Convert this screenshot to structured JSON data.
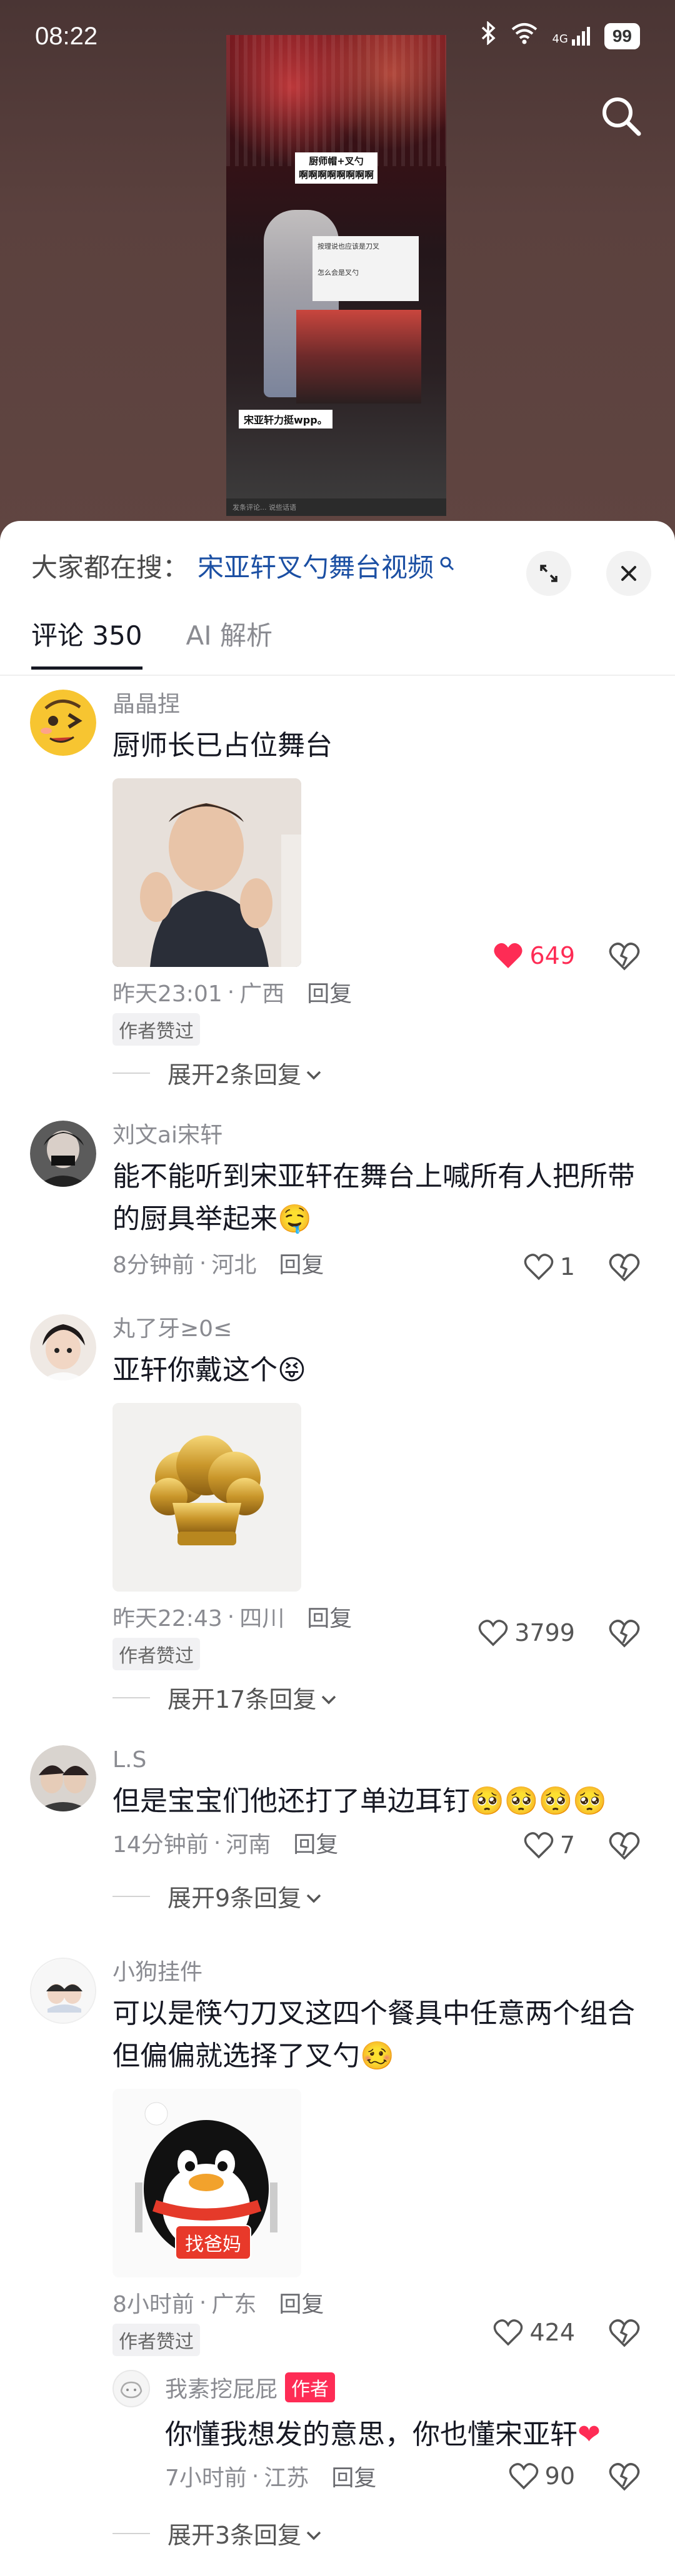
{
  "status_bar": {
    "time": "08:22",
    "battery": "99",
    "network": "4G"
  },
  "video": {
    "caption_top": "厨师帽+叉勺\n啊啊啊啊啊啊啊啊",
    "box_line1": "按理说也应该是刀叉",
    "box_line2": "怎么会是叉勺",
    "caption_bottom": "宋亚轩力挺wpp。",
    "bottom_bar": "发条评论... 说些话语"
  },
  "sheet": {
    "search_prefix": "大家都在搜：",
    "search_link": "宋亚轩叉勺舞台视频",
    "tabs": [
      {
        "label": "评论 350",
        "active": true
      },
      {
        "label": "AI 解析",
        "active": false
      }
    ]
  },
  "comments": [
    {
      "user": "晶晶捏",
      "text": "厨师长已占位舞台",
      "time": "昨天23:01",
      "location": "广西",
      "reply": "回复",
      "likes": "649",
      "liked": true,
      "author_liked": "作者赞过",
      "expand": "展开2条回复"
    },
    {
      "user": "刘文ai宋轩",
      "text": "能不能听到宋亚轩在舞台上喊所有人把所带的厨具举起来",
      "emoji": "🤤",
      "time": "8分钟前",
      "location": "河北",
      "reply": "回复",
      "likes": "1"
    },
    {
      "user": "丸了牙≥0≤",
      "text": "亚轩你戴这个",
      "emoji": "😝",
      "time": "昨天22:43",
      "location": "四川",
      "reply": "回复",
      "likes": "3799",
      "author_liked": "作者赞过",
      "expand": "展开17条回复"
    },
    {
      "user": "L.S",
      "text": "但是宝宝们他还打了单边耳钉",
      "emoji": "🥺🥺🥺🥺",
      "time": "14分钟前",
      "location": "河南",
      "reply": "回复",
      "likes": "7",
      "expand": "展开9条回复"
    },
    {
      "user": "小狗挂件",
      "text": "可以是筷勺刀叉这四个餐具中任意两个组合 但偏偏就选择了叉勺",
      "emoji": "🥴",
      "sticker_label": "找爸妈",
      "time": "8小时前",
      "location": "广东",
      "reply": "回复",
      "likes": "424",
      "author_liked": "作者赞过",
      "sub": {
        "user": "我素挖屁屁",
        "badge": "作者",
        "text": "你懂我想发的意思，你也懂宋亚轩",
        "emoji": "❤",
        "time": "7小时前",
        "location": "江苏",
        "reply": "回复",
        "likes": "90"
      },
      "expand": "展开3条回复"
    }
  ]
}
